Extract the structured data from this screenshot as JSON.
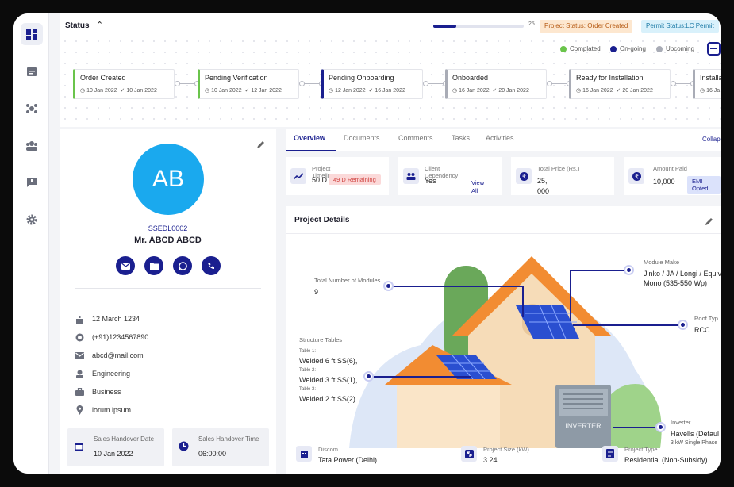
{
  "header": {
    "status_title": "Status",
    "progress_value": 0.25,
    "progress_label": "25",
    "project_status": "Project Status: Order Created",
    "permit_status": "Permit Status:LC Permit"
  },
  "legend": {
    "completed": "Complated",
    "ongoing": "On-going",
    "upcoming": "Upcoming",
    "colors": {
      "completed": "#6ac44b",
      "ongoing": "#1a1f8f",
      "upcoming": "#a9acb6"
    }
  },
  "stages": [
    {
      "name": "Order Created",
      "start": "10 Jan 2022",
      "end": "10 Jan 2022",
      "state": "done"
    },
    {
      "name": "Pending Verification",
      "start": "10 Jan 2022",
      "end": "12 Jan 2022",
      "state": "done"
    },
    {
      "name": "Pending Onboarding",
      "start": "12 Jan 2022",
      "end": "16 Jan 2022",
      "state": "ongoing"
    },
    {
      "name": "Onboarded",
      "start": "16 Jan 2022",
      "end": "20 Jan 2022",
      "state": "upcoming"
    },
    {
      "name": "Ready for Installation",
      "start": "16 Jan 2022",
      "end": "20 Jan 2022",
      "state": "upcoming"
    },
    {
      "name": "Installa",
      "start": "16 Ja",
      "end": "",
      "state": "upcoming"
    }
  ],
  "profile": {
    "initials": "AB",
    "code": "SSEDL0002",
    "name": "Mr. ABCD ABCD",
    "birthday": "12 March 1234",
    "phone": "(+91)1234567890",
    "email": "abcd@mail.com",
    "profession": "Engineering",
    "type": "Business",
    "address": "lorum ipsum",
    "handover_date_label": "Sales Handover Date",
    "handover_date": "10 Jan 2022",
    "handover_time_label": "Sales Handover Time",
    "handover_time": "06:00:00"
  },
  "tabs": [
    "Overview",
    "Documents",
    "Comments",
    "Tasks",
    "Activities"
  ],
  "collapse_label": "Collap",
  "cards": {
    "timeline_label": "Project Timeline",
    "timeline_value": "50 D",
    "timeline_chip": "49 D Remaining",
    "dependency_label": "Client Dependency",
    "dependency_value": "Yes",
    "dependency_link": "View All",
    "price_label": "Total Price (Rs.)",
    "price_value": "25, 000",
    "paid_label": "Amount Paid",
    "paid_value": "10,000",
    "paid_chip": "EMI Opted"
  },
  "details": {
    "title": "Project Details",
    "modules_label": "Total Number of Modules",
    "modules_value": "9",
    "module_make_label": "Module Make",
    "module_make_value": "Jinko / JA / Longi / Equiv. Mono (535-550 Wp)",
    "roof_label": "Roof Typ",
    "roof_value": "RCC",
    "structure_label": "Structure Tables",
    "tables": [
      {
        "label": "Table 1:",
        "value": "Welded 6 ft SS(6),"
      },
      {
        "label": "Table 2:",
        "value": "Welded 3 ft SS(1),"
      },
      {
        "label": "Table 3:",
        "value": "Welded 2 ft SS(2)"
      }
    ],
    "inverter_label": "Inverter",
    "inverter_value": "Havells (Defaul",
    "inverter_sub": "3 kW Single Phase",
    "inverter_text": "INVERTER",
    "discom_label": "Discom",
    "discom_value": "Tata Power (Delhi)",
    "size_label": "Project Size (kW)",
    "size_value": "3.24",
    "ptype_label": "Project Type",
    "ptype_value": "Residential (Non-Subsidy)"
  }
}
